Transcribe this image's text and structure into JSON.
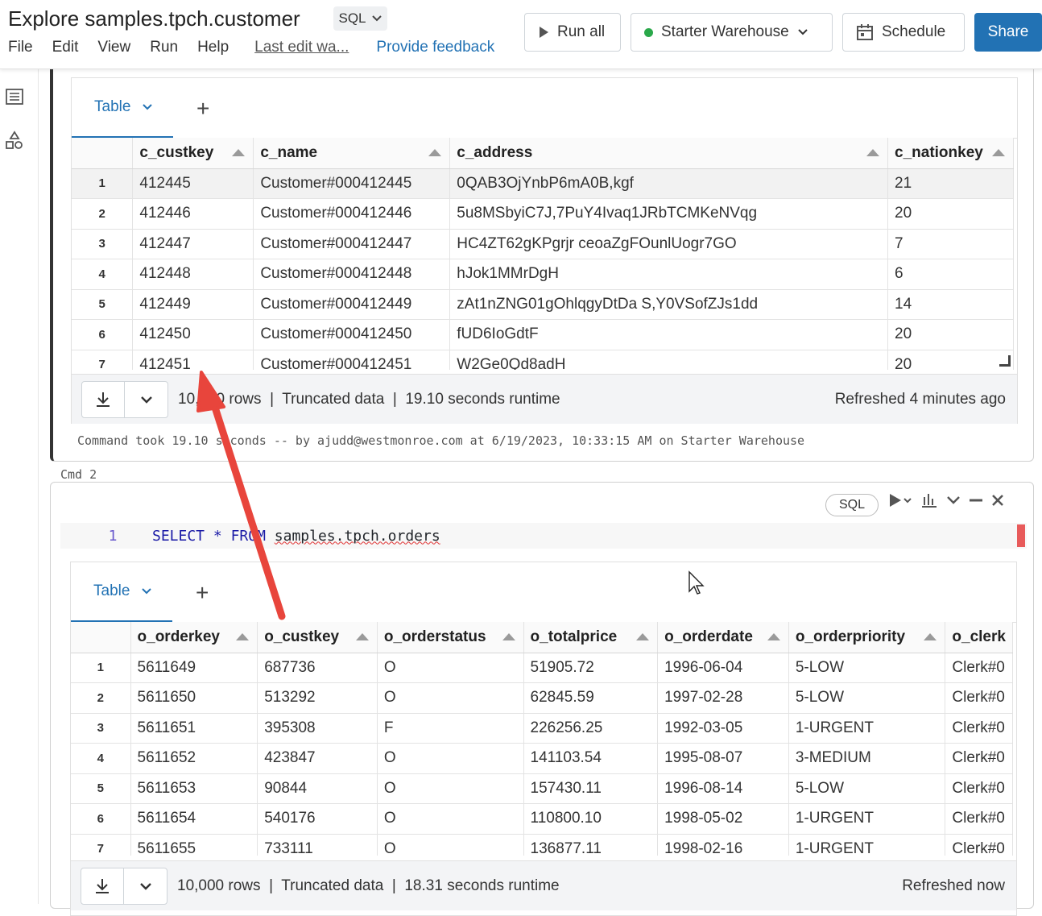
{
  "header": {
    "title": "Explore samples.tpch.customer",
    "language": "SQL",
    "menu": [
      "File",
      "Edit",
      "View",
      "Run",
      "Help"
    ],
    "last_edit": "Last edit wa...",
    "feedback": "Provide feedback",
    "run_all": "Run all",
    "warehouse": "Starter Warehouse",
    "schedule": "Schedule",
    "share": "Share"
  },
  "cell1": {
    "tab_label": "Table",
    "columns": [
      "c_custkey",
      "c_name",
      "c_address",
      "c_nationkey"
    ],
    "rows": [
      [
        "1",
        "412445",
        "Customer#000412445",
        "0QAB3OjYnbP6mA0B,kgf",
        "21"
      ],
      [
        "2",
        "412446",
        "Customer#000412446",
        "5u8MSbyiC7J,7PuY4Ivaq1JRbTCMKeNVqg",
        "20"
      ],
      [
        "3",
        "412447",
        "Customer#000412447",
        "HC4ZT62gKPgrjr ceoaZgFOunlUogr7GO",
        "7"
      ],
      [
        "4",
        "412448",
        "Customer#000412448",
        "hJok1MMrDgH",
        "6"
      ],
      [
        "5",
        "412449",
        "Customer#000412449",
        "zAt1nZNG01gOhlqgyDtDa S,Y0VSofZJs1dd",
        "14"
      ],
      [
        "6",
        "412450",
        "Customer#000412450",
        "fUD6IoGdtF",
        "20"
      ],
      [
        "7",
        "412451",
        "Customer#000412451",
        "W2Ge0Qd8adH",
        "20"
      ]
    ],
    "footer_text": "10,000 rows  |  Truncated data  |  19.10 seconds runtime",
    "refreshed": "Refreshed 4 minutes ago",
    "command_took": "Command took 19.10 seconds -- by ajudd@westmonroe.com at 6/19/2023, 10:33:15 AM on Starter Warehouse"
  },
  "cmd_label": "Cmd 2",
  "cell2": {
    "language": "SQL",
    "line_number": "1",
    "code_keyword1": "SELECT",
    "code_star": "*",
    "code_keyword2": "FROM",
    "code_table": "samples.tpch.orders",
    "tab_label": "Table",
    "columns": [
      "o_orderkey",
      "o_custkey",
      "o_orderstatus",
      "o_totalprice",
      "o_orderdate",
      "o_orderpriority",
      "o_clerk"
    ],
    "rows": [
      [
        "1",
        "5611649",
        "687736",
        "O",
        "51905.72",
        "1996-06-04",
        "5-LOW",
        "Clerk#0"
      ],
      [
        "2",
        "5611650",
        "513292",
        "O",
        "62845.59",
        "1997-02-28",
        "5-LOW",
        "Clerk#0"
      ],
      [
        "3",
        "5611651",
        "395308",
        "F",
        "226256.25",
        "1992-03-05",
        "1-URGENT",
        "Clerk#0"
      ],
      [
        "4",
        "5611652",
        "423847",
        "O",
        "141103.54",
        "1995-08-07",
        "3-MEDIUM",
        "Clerk#0"
      ],
      [
        "5",
        "5611653",
        "90844",
        "O",
        "157430.11",
        "1996-08-14",
        "5-LOW",
        "Clerk#0"
      ],
      [
        "6",
        "5611654",
        "540176",
        "O",
        "110800.10",
        "1998-05-02",
        "1-URGENT",
        "Clerk#0"
      ],
      [
        "7",
        "5611655",
        "733111",
        "O",
        "136877.11",
        "1998-02-16",
        "1-URGENT",
        "Clerk#0"
      ]
    ],
    "footer_text": "10,000 rows  |  Truncated data  |  18.31 seconds runtime",
    "refreshed": "Refreshed now"
  },
  "colors": {
    "accent": "#2272b4",
    "status_dot": "#2aa84a",
    "annotation_arrow": "#e8453c"
  }
}
